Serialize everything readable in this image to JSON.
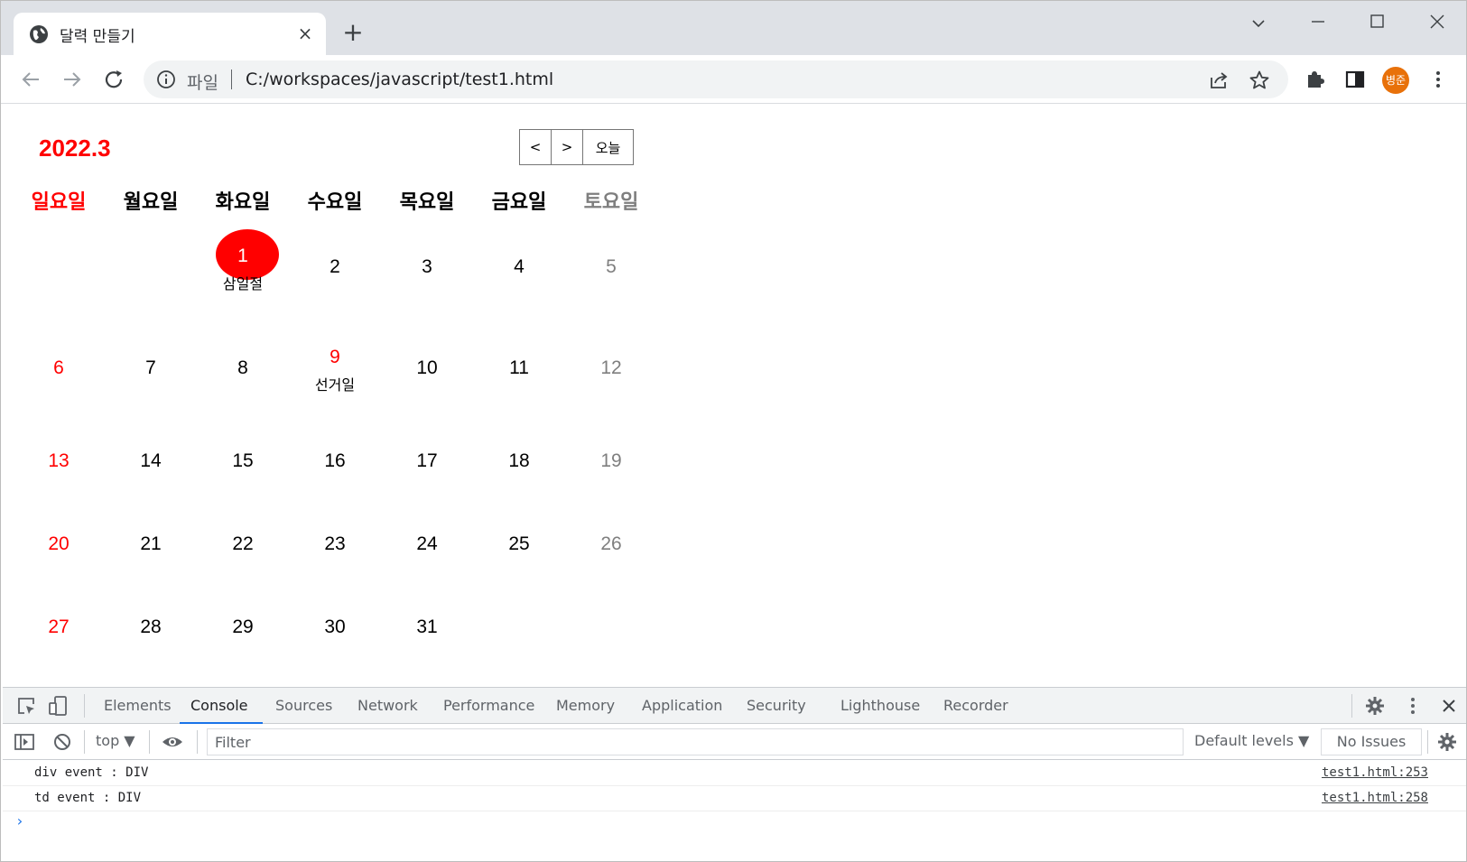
{
  "browser": {
    "tab_title": "달력 만들기",
    "tab_close": "×",
    "new_tab": "+",
    "address_scheme": "파일",
    "address_url": "C:/workspaces/javascript/test1.html",
    "profile_initials": "병준"
  },
  "calendar": {
    "title": "2022.3",
    "prev_label": "<",
    "next_label": ">",
    "today_label": "오늘",
    "weekdays": [
      "일요일",
      "월요일",
      "화요일",
      "수요일",
      "목요일",
      "금요일",
      "토요일"
    ],
    "weekday_colors": [
      "#ff0000",
      "#000000",
      "#000000",
      "#000000",
      "#000000",
      "#000000",
      "#7f7f7f"
    ],
    "weeks": [
      [
        "",
        "",
        "1",
        "2",
        "3",
        "4",
        "5"
      ],
      [
        "6",
        "7",
        "8",
        "9",
        "10",
        "11",
        "12"
      ],
      [
        "13",
        "14",
        "15",
        "16",
        "17",
        "18",
        "19"
      ],
      [
        "20",
        "21",
        "22",
        "23",
        "24",
        "25",
        "26"
      ],
      [
        "27",
        "28",
        "29",
        "30",
        "31",
        "",
        ""
      ]
    ],
    "today": "1",
    "holidays": [
      {
        "day": "1",
        "name": "삼일절"
      },
      {
        "day": "9",
        "name": "선거일"
      }
    ],
    "colors": {
      "sunday": "#ff0000",
      "saturday": "#7f7f7f",
      "today_bg": "#ff0000",
      "holiday": "#ff0000"
    }
  },
  "devtools": {
    "tabs": [
      "Elements",
      "Console",
      "Sources",
      "Network",
      "Performance",
      "Memory",
      "Application",
      "Security",
      "Lighthouse",
      "Recorder"
    ],
    "active_tab": "Console",
    "context": "top ▼",
    "filter_placeholder": "Filter",
    "levels": "Default levels ▼",
    "issues": "No Issues",
    "logs": [
      {
        "message": "div event : DIV",
        "source": "test1.html:253"
      },
      {
        "message": "td event : DIV",
        "source": "test1.html:258"
      }
    ],
    "prompt": "›"
  }
}
